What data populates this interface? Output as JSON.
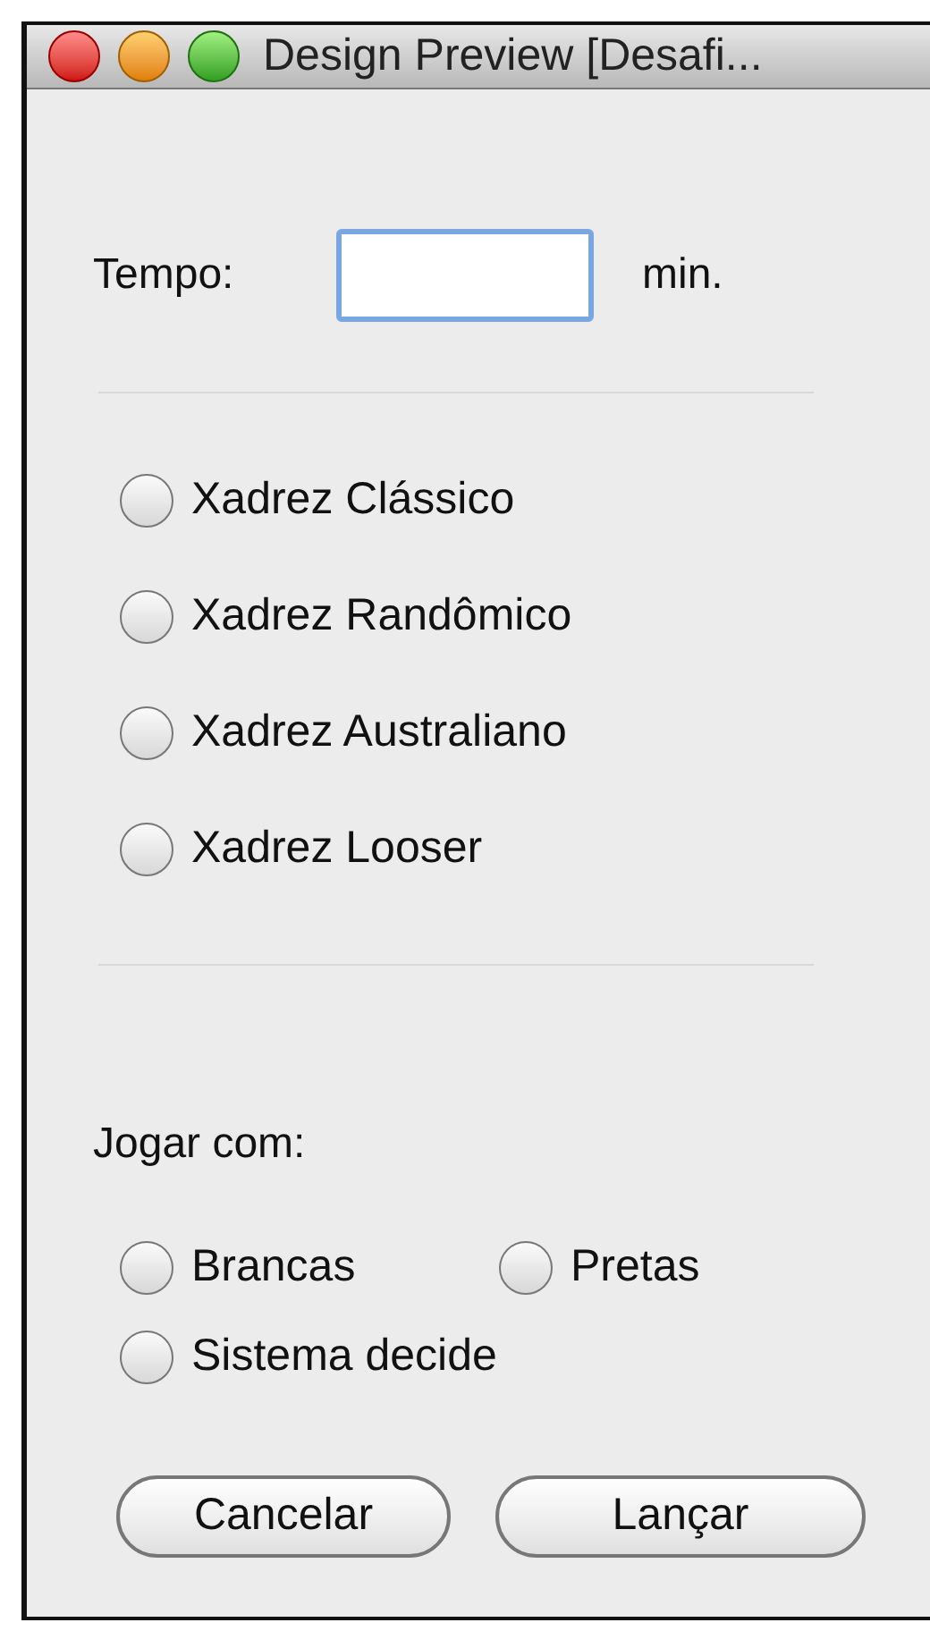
{
  "window": {
    "title": "Design Preview [Desafi..."
  },
  "time": {
    "label": "Tempo:",
    "unit": "min."
  },
  "variants": [
    {
      "label": "Xadrez Clássico",
      "selected": false
    },
    {
      "label": "Xadrez Randômico",
      "selected": false
    },
    {
      "label": "Xadrez Australiano",
      "selected": false
    },
    {
      "label": "Xadrez Looser",
      "selected": false
    }
  ],
  "play_with": {
    "label": "Jogar com:",
    "options": [
      {
        "label": "Brancas",
        "selected": false
      },
      {
        "label": "Pretas",
        "selected": false
      },
      {
        "label": "Sistema decide",
        "selected": false
      }
    ]
  },
  "buttons": [
    "Cancelar",
    "Lançar"
  ]
}
